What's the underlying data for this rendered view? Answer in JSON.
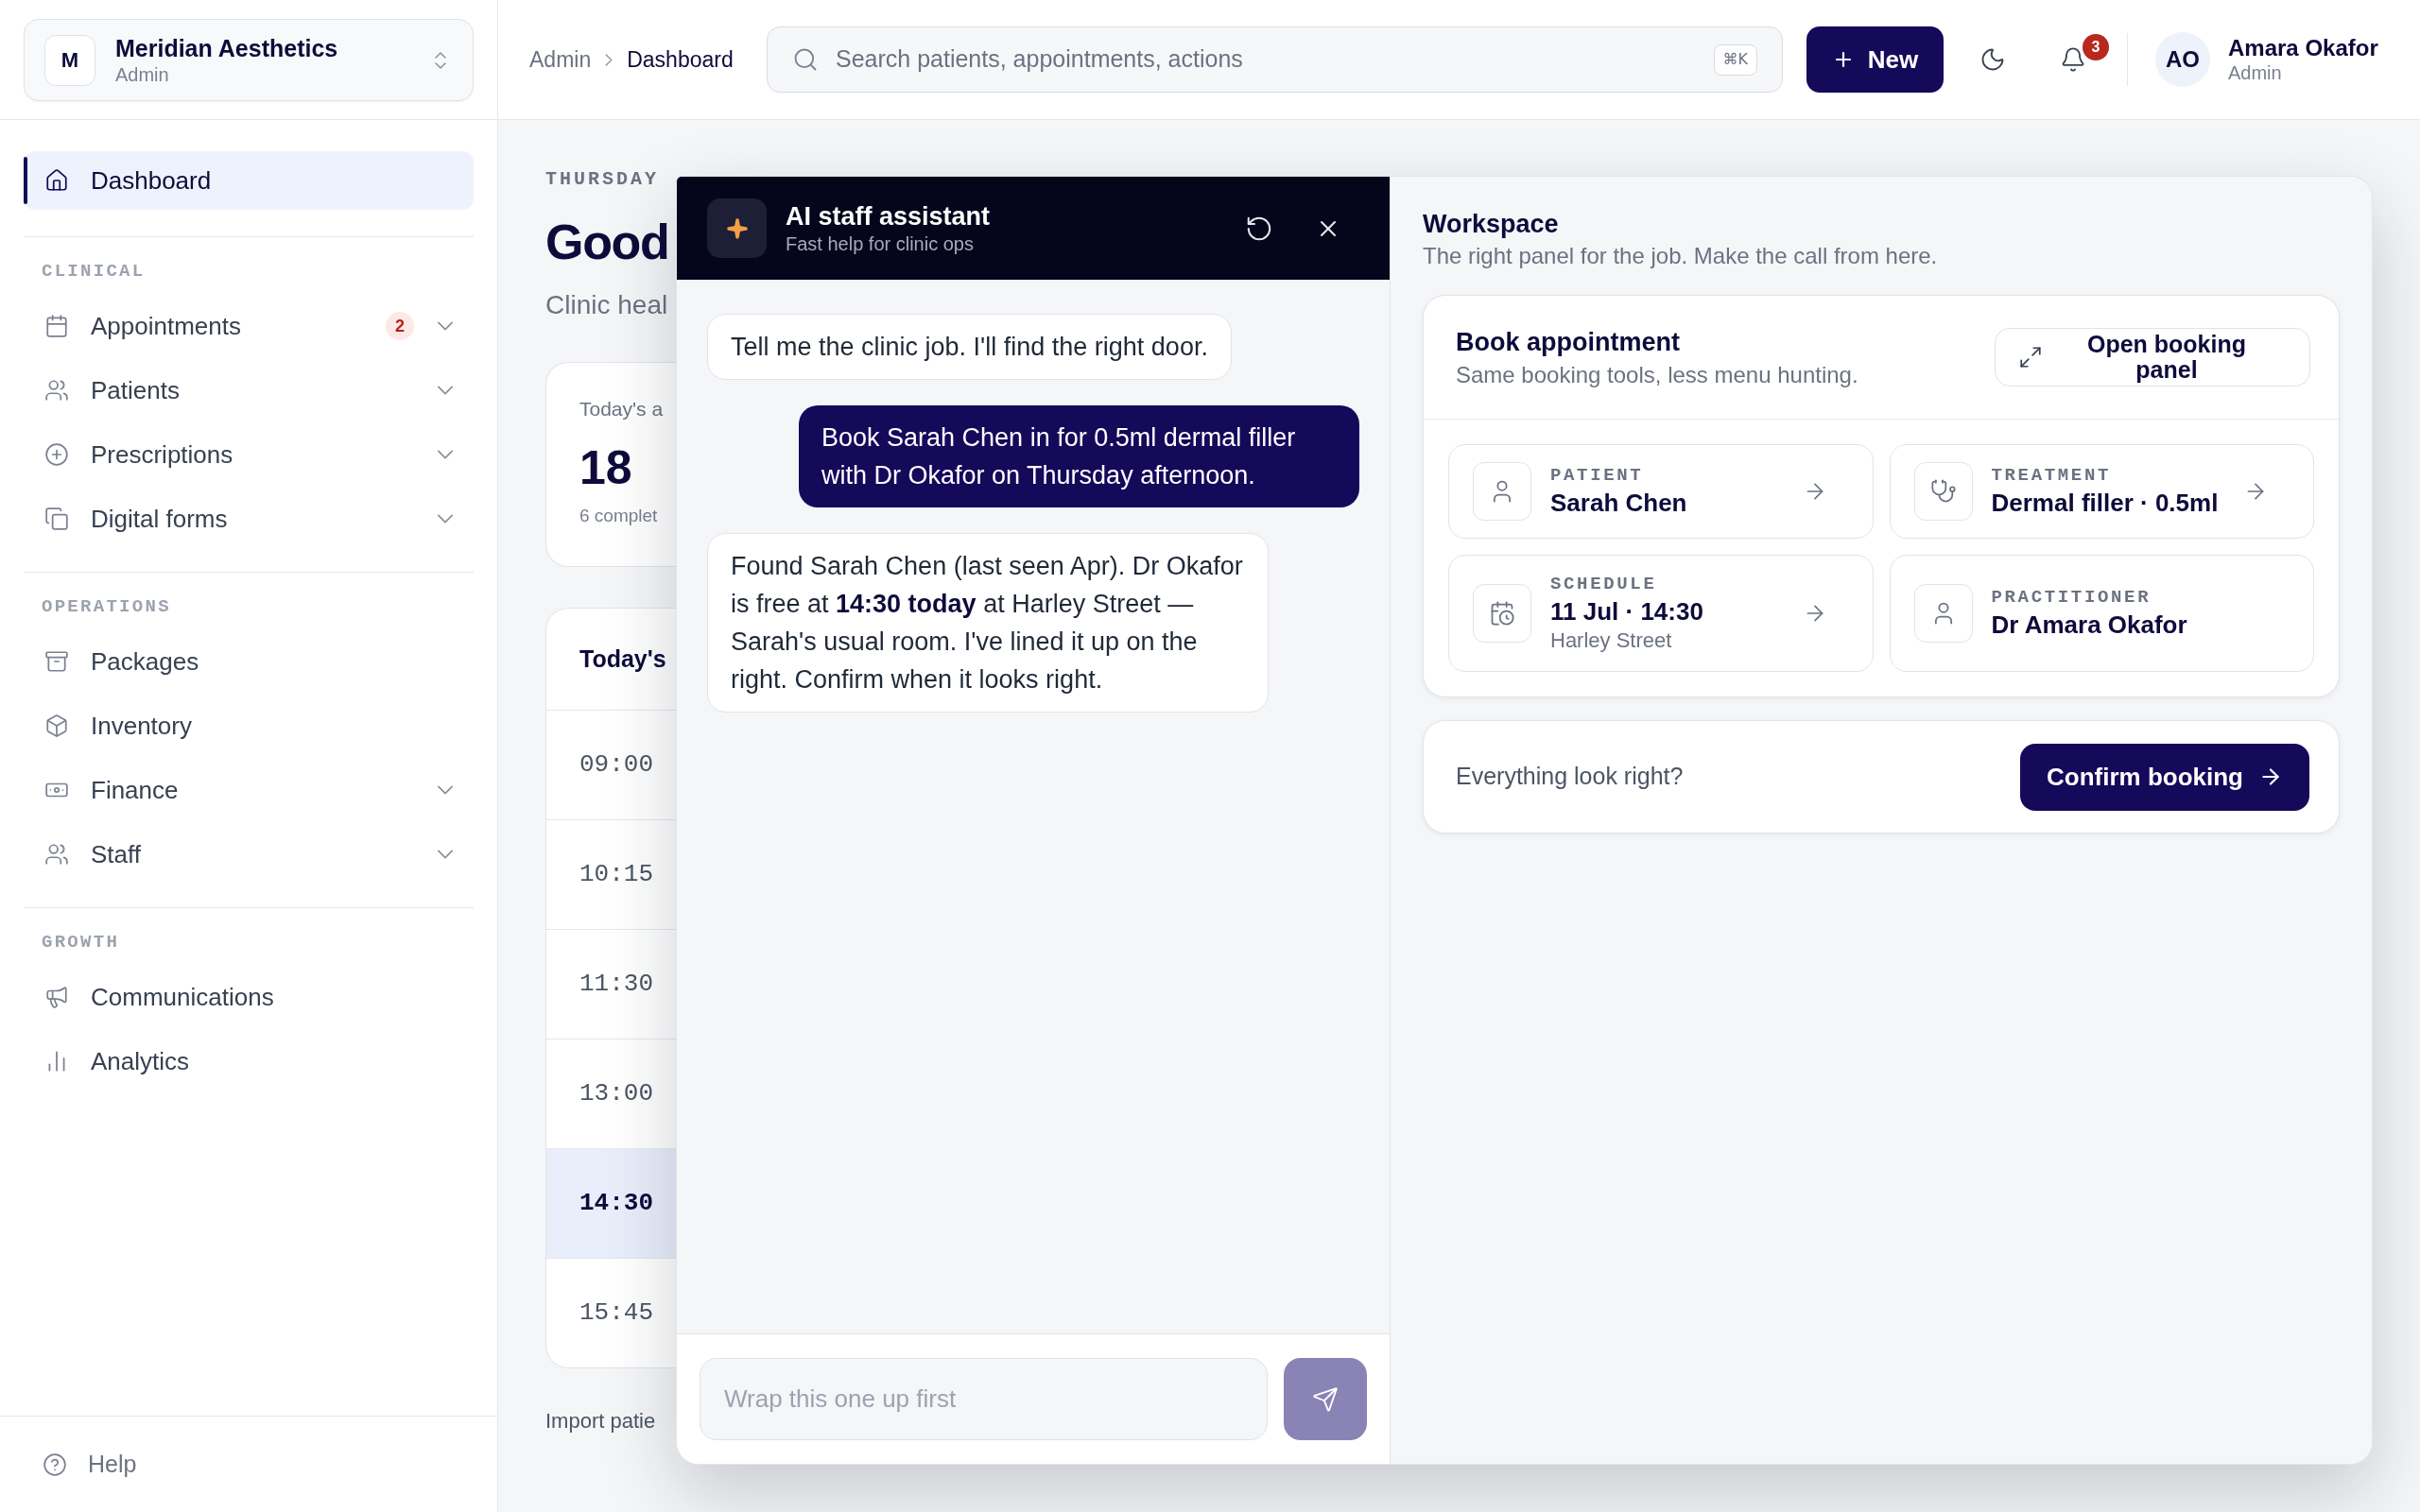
{
  "sidebar": {
    "org": {
      "initial": "M",
      "name": "Meridian Aesthetics",
      "role": "Admin"
    },
    "nav": [
      {
        "label": "Dashboard",
        "expandable": false,
        "selected": true
      }
    ],
    "sections": [
      {
        "title": "CLINICAL",
        "items": [
          {
            "label": "Appointments",
            "badge": "2",
            "expandable": true,
            "selected": false
          },
          {
            "label": "Patients",
            "expandable": true,
            "selected": false
          },
          {
            "label": "Prescriptions",
            "expandable": true,
            "selected": false
          },
          {
            "label": "Digital forms",
            "expandable": true,
            "selected": false
          }
        ]
      },
      {
        "title": "OPERATIONS",
        "items": [
          {
            "label": "Packages",
            "expandable": false,
            "selected": false
          },
          {
            "label": "Inventory",
            "expandable": false,
            "selected": false
          },
          {
            "label": "Finance",
            "expandable": true,
            "selected": false
          },
          {
            "label": "Staff",
            "expandable": true,
            "selected": false
          }
        ]
      },
      {
        "title": "GROWTH",
        "items": [
          {
            "label": "Communications",
            "expandable": false,
            "selected": false
          },
          {
            "label": "Analytics",
            "expandable": false,
            "selected": false
          }
        ]
      }
    ],
    "footer": {
      "label": "Help"
    }
  },
  "topbar": {
    "breadcrumbs": [
      "Admin",
      "Dashboard"
    ],
    "search": {
      "placeholder": "Search patients, appointments, actions",
      "shortcut": "⌘K"
    },
    "new_button": "New",
    "notifications": {
      "count": "3"
    },
    "user": {
      "initials": "AO",
      "name": "Amara Okafor",
      "role": "Admin"
    }
  },
  "main": {
    "date": "THURSDAY",
    "greeting": "Good",
    "subtitle": "Clinic heal",
    "stat_card": {
      "label": "Today's a",
      "value": "18",
      "note": "6 complet"
    },
    "schedule": {
      "title": "Today's",
      "slots": [
        {
          "time": "09:00",
          "selected": false
        },
        {
          "time": "10:15",
          "selected": false
        },
        {
          "time": "11:30",
          "selected": false
        },
        {
          "time": "13:00",
          "selected": false
        },
        {
          "time": "14:30",
          "selected": true
        },
        {
          "time": "15:45",
          "selected": false
        }
      ]
    },
    "import_link": "Import patie"
  },
  "assistant": {
    "title": "AI staff assistant",
    "subtitle": "Fast help for clinic ops",
    "messages": [
      {
        "kind": "assistant",
        "text": "Tell me the clinic job. I'll find the right door."
      },
      {
        "kind": "user",
        "text": "Book Sarah Chen in for 0.5ml dermal filler with Dr Okafor on Thursday afternoon."
      },
      {
        "kind": "assistant",
        "text": "Found Sarah Chen (last seen Apr). Dr Okafor is free at **14:30 today** at Harley Street — Sarah's usual room. I've lined it up on the right. Confirm when it looks right."
      }
    ],
    "composer": {
      "placeholder": "Wrap this one up first",
      "send_disabled": true
    }
  },
  "workspace": {
    "title": "Workspace",
    "subtitle": "The right panel for the job. Make the call from here.",
    "booking": {
      "title": "Book appointment",
      "subtitle": "Same booking tools, less menu hunting.",
      "open_button": "Open booking panel",
      "fields": [
        {
          "label": "PATIENT",
          "value": "Sarah Chen",
          "navigable": true
        },
        {
          "label": "TREATMENT",
          "value": "Dermal filler · 0.5ml",
          "navigable": true
        },
        {
          "label": "SCHEDULE",
          "value": "11 Jul · 14:30",
          "detail": "Harley Street",
          "navigable": true
        },
        {
          "label": "PRACTITIONER",
          "value": "Dr Amara Okafor",
          "navigable": false
        }
      ]
    },
    "confirm": {
      "prompt": "Everything look right?",
      "button": "Confirm booking"
    }
  }
}
